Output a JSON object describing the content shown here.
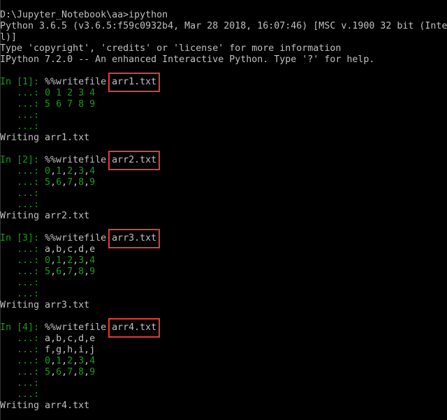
{
  "colors": {
    "background": "#000000",
    "text": "#c0c0c0",
    "prompt": "#1a9a1a",
    "highlight_box": "#e8393a"
  },
  "lines": [
    {
      "text": "D:\\Jupyter_Notebook\\aa>ipython"
    },
    {
      "text": "Python 3.6.5 (v3.6.5:f59c0932b4, Mar 28 2018, 16:07:46) [MSC v.1900 32 bit (Inte"
    },
    {
      "text": "l)]"
    },
    {
      "text": "Type 'copyright', 'credits' or 'license' for more information"
    },
    {
      "text": "IPython 7.2.0 -- An enhanced Interactive Python. Type '?' for help."
    },
    {
      "text": ""
    },
    {
      "prompt": "In [1]: ",
      "text": "%%writefile ",
      "file": "arr1.txt"
    },
    {
      "prompt": "   ...: ",
      "text": "0 1 2 3 4"
    },
    {
      "prompt": "   ...: ",
      "text": "5 6 7 8 9"
    },
    {
      "prompt": "   ...: ",
      "text": ""
    },
    {
      "prompt": "   ...: ",
      "text": ""
    },
    {
      "text": "Writing arr1.txt"
    },
    {
      "text": ""
    },
    {
      "prompt": "In [2]: ",
      "text": "%%writefile ",
      "file": "arr2.txt"
    },
    {
      "prompt": "   ...: ",
      "text": "0,1,2,3,4"
    },
    {
      "prompt": "   ...: ",
      "text": "5,6,7,8,9"
    },
    {
      "prompt": "   ...: ",
      "text": ""
    },
    {
      "prompt": "   ...: ",
      "text": ""
    },
    {
      "text": "Writing arr2.txt"
    },
    {
      "text": ""
    },
    {
      "prompt": "In [3]: ",
      "text": "%%writefile ",
      "file": "arr3.txt"
    },
    {
      "prompt": "   ...: ",
      "text": "a,b,c,d,e"
    },
    {
      "prompt": "   ...: ",
      "text": "0,1,2,3,4"
    },
    {
      "prompt": "   ...: ",
      "text": "5,6,7,8,9"
    },
    {
      "prompt": "   ...: ",
      "text": ""
    },
    {
      "prompt": "   ...: ",
      "text": ""
    },
    {
      "text": "Writing arr3.txt"
    },
    {
      "text": ""
    },
    {
      "prompt": "In [4]: ",
      "text": "%%writefile ",
      "file": "arr4.txt"
    },
    {
      "prompt": "   ...: ",
      "text": "a,b,c,d,e"
    },
    {
      "prompt": "   ...: ",
      "text": "f,g,h,i,j"
    },
    {
      "prompt": "   ...: ",
      "text": "0,1,2,3,4"
    },
    {
      "prompt": "   ...: ",
      "text": "5,6,7,8,9"
    },
    {
      "prompt": "   ...: ",
      "text": ""
    },
    {
      "prompt": "   ...: ",
      "text": ""
    },
    {
      "text": "Writing arr4.txt"
    }
  ]
}
